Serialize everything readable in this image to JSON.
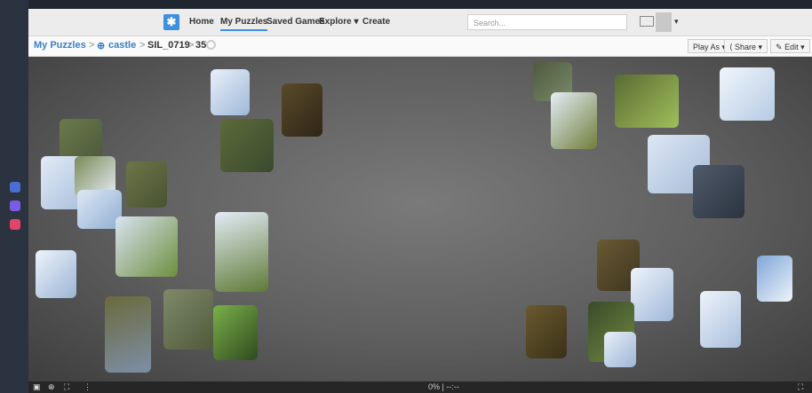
{
  "nav": {
    "logo_glyph": "✱",
    "links": [
      "Home",
      "My Puzzles",
      "Saved Games",
      "Explore ▾",
      "Create"
    ],
    "search_placeholder": "Search...",
    "user_menu_caret": "▾"
  },
  "breadcrumb": {
    "root": "My Puzzles",
    "sep1": ">",
    "globe": "⊕",
    "collection": "castle",
    "sep2": ">",
    "puzzle": "SIL_0719",
    "sep3": ">",
    "pieces": "35"
  },
  "toolbar": {
    "play_as": "Play As ▾",
    "share": "Share ▾",
    "edit": "Edit ▾"
  },
  "footer": {
    "progress": "0%",
    "timer": "--:--",
    "separator": "|"
  },
  "icons": {
    "left_dock": [
      "app-a-icon",
      "messenger-icon",
      "instagram-icon"
    ],
    "bottom": [
      "board-icon",
      "zoom-icon",
      "fit-icon",
      "more-icon",
      "fullscreen-icon"
    ]
  },
  "colors": {
    "accent": "#3d8fe0",
    "link": "#3a7fc7",
    "board": "#5e5e5e",
    "dock": "#2b3340"
  }
}
